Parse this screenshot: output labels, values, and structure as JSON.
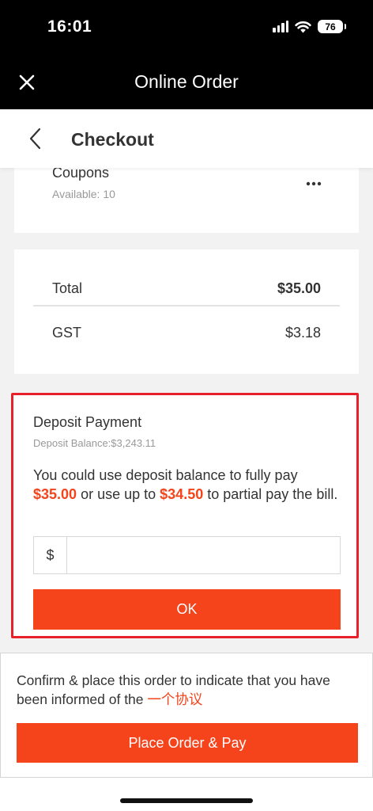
{
  "status_bar": {
    "time": "16:01",
    "battery": "76"
  },
  "header": {
    "title": "Online Order"
  },
  "checkout_bar": {
    "title": "Checkout"
  },
  "coupons": {
    "title": "Coupons",
    "available": "Available: 10"
  },
  "totals": {
    "total_label": "Total",
    "total_value": "$35.00",
    "gst_label": "GST",
    "gst_value": "$3.18"
  },
  "deposit": {
    "title": "Deposit Payment",
    "balance": "Deposit Balance:$3,243.11",
    "msg_part1": "You could use deposit balance to fully pay",
    "full_amount": "$35.00",
    "msg_part2": "or use up to",
    "partial_amount": "$34.50",
    "msg_part3": "to partial pay the bill.",
    "currency_prefix": "$",
    "amount_value": "",
    "ok_label": "OK"
  },
  "footer": {
    "confirm_text": "Confirm & place this order to indicate that you have been informed of the",
    "agreement_link": "一个协议",
    "place_order_label": "Place Order & Pay"
  },
  "colors": {
    "accent": "#f5431c",
    "highlight_border": "#e8202a",
    "header_bg": "#000000"
  }
}
